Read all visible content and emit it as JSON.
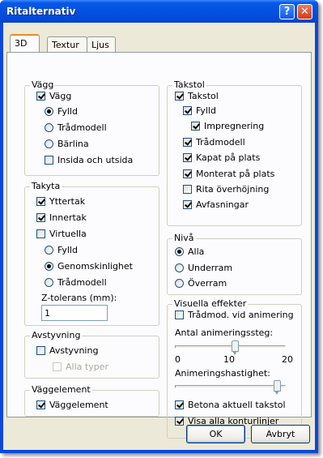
{
  "window": {
    "title": "Ritalternativ",
    "help_glyph": "?",
    "close_glyph": "✕"
  },
  "tabs": [
    {
      "label": "3D"
    },
    {
      "label": "Textur"
    },
    {
      "label": "Ljus"
    }
  ],
  "vagg": {
    "legend": "Vägg",
    "vagg_label": "Vägg",
    "fylld": "Fylld",
    "tradmodell": "Trådmodell",
    "barlina": "Bärlina",
    "insida": "Insida och utsida"
  },
  "takyta": {
    "legend": "Takyta",
    "yttertak": "Yttertak",
    "innertak": "Innertak",
    "virtuella": "Virtuella",
    "fylld": "Fylld",
    "genomskinlighet": "Genomskinlighet",
    "tradmodell": "Trådmodell",
    "ztol_label": "Z-tolerans (mm):",
    "ztol_value": "1"
  },
  "avstyvning": {
    "legend": "Avstyvning",
    "avstyvning_label": "Avstyvning",
    "alla_typer": "Alla typer"
  },
  "vaggelement": {
    "legend": "Väggelement",
    "label": "Väggelement"
  },
  "takstol": {
    "legend": "Takstol",
    "takstol_label": "Takstol",
    "fylld": "Fylld",
    "impregnering": "Impregnering",
    "tradmodell": "Trådmodell",
    "kapat": "Kapat på plats",
    "monterat": "Monterat på plats",
    "rita": "Rita överhöjning",
    "avfasningar": "Avfasningar"
  },
  "niva": {
    "legend": "Nivå",
    "alla": "Alla",
    "underram": "Underram",
    "overram": "Överram"
  },
  "visuella": {
    "legend": "Visuella effekter",
    "tradmod_anim": "Trådmod. vid animering",
    "antal_label": "Antal animeringssteg:",
    "antal_value": 11,
    "antal_min": 0,
    "antal_max": 20,
    "tick_min": "0",
    "tick_mid": "10",
    "tick_max": "20",
    "hastighet_label": "Animeringshastighet:",
    "hastighet_fraction": 0.95,
    "betona": "Betona aktuell takstol",
    "visa": "Visa alla konturlinjer"
  },
  "buttons": {
    "ok": "OK",
    "cancel": "Avbryt"
  }
}
